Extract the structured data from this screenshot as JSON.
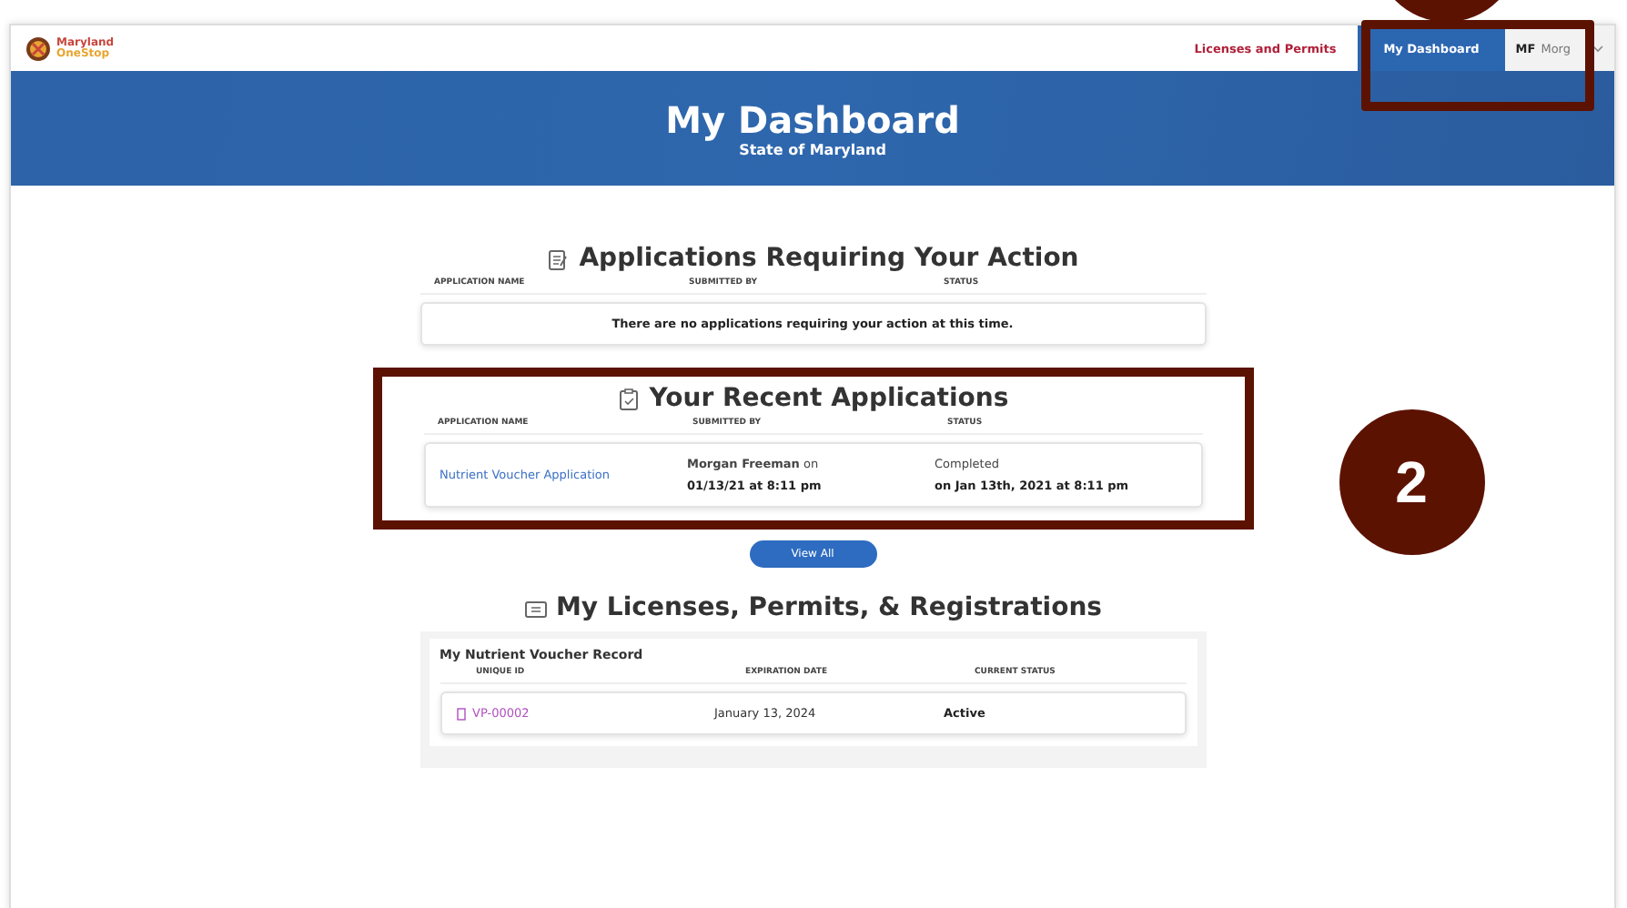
{
  "header": {
    "logo_lines": [
      "Maryland",
      "OneStop"
    ],
    "nav": [
      {
        "label": "Licenses and Permits",
        "selected": false
      },
      {
        "label": "My Dashboard",
        "selected": true
      }
    ],
    "user": {
      "initials": "MF",
      "name": "Morg"
    },
    "highlighted": true,
    "callout": {
      "shown": true
    }
  },
  "banner": {
    "title": "My Dashboard",
    "subtitle": "State of Maryland"
  },
  "action_section": {
    "title": "Applications Requiring Your Action",
    "columns": [
      "APPLICATION NAME",
      "SUBMITTED BY",
      "STATUS"
    ],
    "empty_message": "There are no applications requiring your action at this time."
  },
  "recent_section": {
    "title": "Your Recent Applications",
    "columns": [
      "APPLICATION NAME",
      "SUBMITTED BY",
      "STATUS"
    ],
    "highlighted": true,
    "callout": {
      "label": "2"
    },
    "rows": [
      {
        "application_name": "Nutrient Voucher Application",
        "submitted_by": "**Morgan Freeman** on",
        "submitted_date": "01/13/21 at 8:11 pm",
        "status": "Completed",
        "status_date": "on Jan 13th, 2021 at 8:11 pm"
      }
    ]
  },
  "view_all_button": "View All",
  "licenses_section": {
    "title": "My Licenses, Permits, & Registrations",
    "record_title": "My Nutrient Voucher Record",
    "columns": [
      "UNIQUE ID",
      "EXPIRATION DATE",
      "CURRENT STATUS"
    ],
    "rows": [
      {
        "unique_id": "VP-00002",
        "expiration_date": "January 13, 2024",
        "current_status": "Active"
      }
    ]
  }
}
